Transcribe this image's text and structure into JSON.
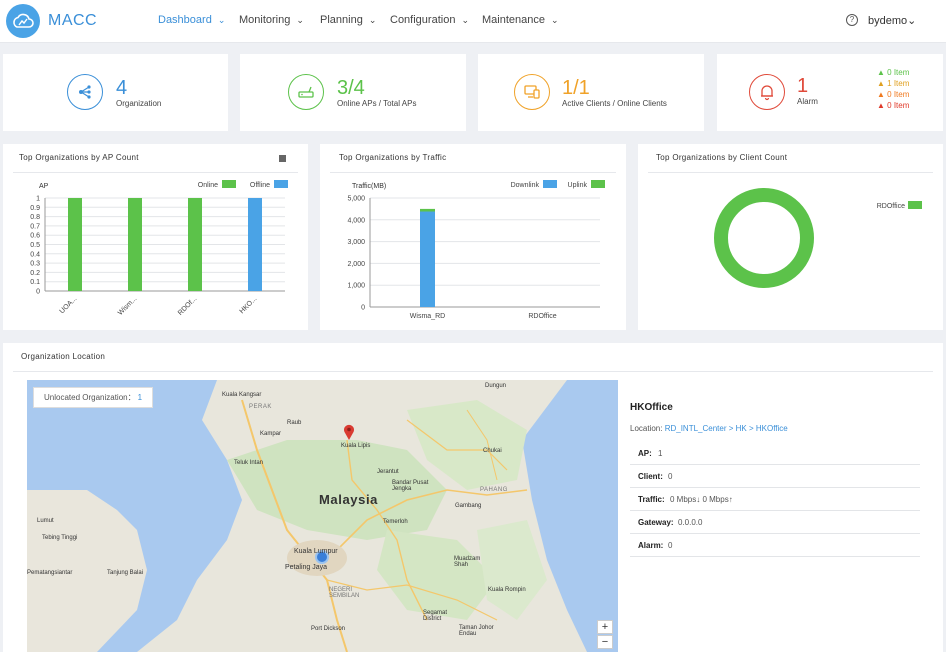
{
  "nav": {
    "brand": "MACC",
    "menu": [
      {
        "label": "Dashboard"
      },
      {
        "label": "Monitoring"
      },
      {
        "label": "Planning"
      },
      {
        "label": "Configuration"
      },
      {
        "label": "Maintenance"
      }
    ],
    "user": "bydemo",
    "help_glyph": "?",
    "chevron": "⌄"
  },
  "stats": {
    "organization": {
      "value": "4",
      "label": "Organization",
      "color": "#3a8fd8",
      "icon": "network-icon"
    },
    "aps": {
      "value": "3/4",
      "label": "Online APs / Total APs",
      "color": "#5cc24a",
      "icon": "router-icon"
    },
    "clients": {
      "value": "1/1",
      "label": "Active Clients / Online Clients",
      "color": "#f0a228",
      "icon": "devices-icon"
    },
    "alarm": {
      "value": "1",
      "label": "Alarm",
      "color": "#e04a3a",
      "icon": "bell-icon",
      "levels": [
        {
          "text": "0 Item",
          "color": "#5cc24a"
        },
        {
          "text": "1 Item",
          "color": "#f0c020"
        },
        {
          "text": "0 Item",
          "color": "#f07a20"
        },
        {
          "text": "0 Item",
          "color": "#e03a2a"
        }
      ]
    }
  },
  "panels": {
    "ap_count": {
      "title": "Top Organizations by AP Count"
    },
    "traffic": {
      "title": "Top Organizations by Traffic"
    },
    "client_count": {
      "title": "Top Organizations by Client Count"
    },
    "location": {
      "title": "Organization Location"
    }
  },
  "chart_data": [
    {
      "type": "bar",
      "title": "Top Organizations by AP Count",
      "ylabel": "AP",
      "categories": [
        "UOA...",
        "Wism...",
        "RDOf...",
        "HKO..."
      ],
      "series": [
        {
          "name": "Online",
          "color": "#5cc24a",
          "values": [
            1,
            1,
            1,
            0
          ]
        },
        {
          "name": "Offline",
          "color": "#4aa3e6",
          "values": [
            0,
            0,
            0,
            1
          ]
        }
      ],
      "ylim": [
        0,
        1
      ],
      "yticks": [
        "0",
        "0.1",
        "0.2",
        "0.3",
        "0.4",
        "0.5",
        "0.6",
        "0.7",
        "0.8",
        "0.9",
        "1"
      ],
      "legend": "top-right",
      "grid": true
    },
    {
      "type": "bar",
      "title": "Top Organizations by Traffic",
      "ylabel": "Traffic(MB)",
      "categories": [
        "Wisma_RD",
        "RDOffice"
      ],
      "series": [
        {
          "name": "Downlink",
          "color": "#4aa3e6",
          "values": [
            4380,
            0
          ]
        },
        {
          "name": "Uplink",
          "color": "#5cc24a",
          "values": [
            120,
            0
          ]
        }
      ],
      "ylim": [
        0,
        5000
      ],
      "yticks": [
        "0",
        "1,000",
        "2,000",
        "3,000",
        "4,000",
        "5,000"
      ],
      "legend": "top-right",
      "grid": true
    },
    {
      "type": "pie",
      "title": "Top Organizations by Client Count",
      "series": [
        {
          "name": "RDOffice",
          "color": "#5cc24a",
          "values": [
            1
          ]
        }
      ],
      "legend": "top-right"
    }
  ],
  "map": {
    "unlocated_label": "Unlocated Organization：",
    "unlocated_count": "1",
    "zoom_in": "+",
    "zoom_out": "−",
    "labels": {
      "country": "Malaysia",
      "kuala_lipis": "Kuala Lipis",
      "kuala_kangsar": "Kuala Kangsar",
      "kampar": "Kampar",
      "teluk_intan": "Teluk Intan",
      "dungun": "Dungun",
      "chukai": "Chukai",
      "jerantut": "Jerantut",
      "bandar_pusat": "Bandar Pusat Jengka",
      "temerloh": "Temerloh",
      "kuala_lumpur": "Kuala Lumpur",
      "petaling_jaya": "Petaling Jaya",
      "port_dickson": "Port Dickson",
      "muadzam": "Muadzam Shah",
      "gambang": "Gambang",
      "perak": "PERAK",
      "pahang": "PAHANG",
      "negeri": "NEGERI SEMBILAN",
      "segamat": "Segamat District",
      "kuala_rompin": "Kuala Rompin",
      "tanjung_balai": "Tanjung Balai",
      "tebing": "Tebing Tinggi",
      "pematang": "Pematangsiantar",
      "lumut": "Lumut",
      "taman": "Taman Johor Endau",
      "raub": "Raub"
    }
  },
  "detail": {
    "title": "HKOffice",
    "location_label": "Location:",
    "location_value": "RD_INTL_Center > HK > HKOffice",
    "rows": [
      {
        "key": "AP:",
        "value": "1"
      },
      {
        "key": "Client:",
        "value": "0"
      },
      {
        "key": "Traffic:",
        "value": "0 Mbps↓   0 Mbps↑"
      },
      {
        "key": "Gateway:",
        "value": "0.0.0.0"
      },
      {
        "key": "Alarm:",
        "value": "0"
      }
    ]
  }
}
